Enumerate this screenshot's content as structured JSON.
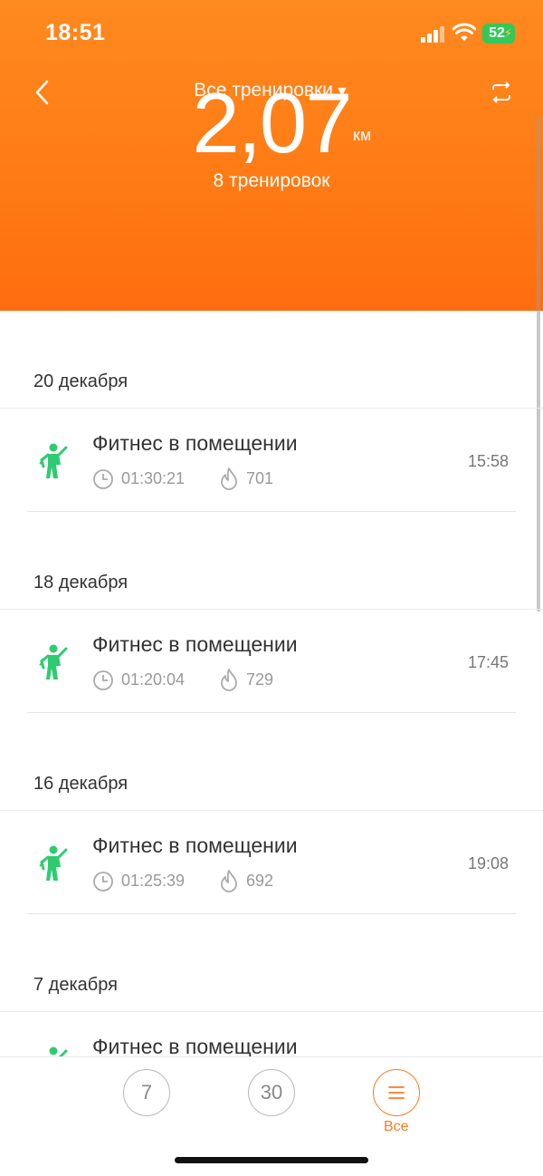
{
  "status_bar": {
    "time": "18:51",
    "battery": "52"
  },
  "header": {
    "title": "Все тренировки",
    "total_distance": "2,07",
    "unit": "км",
    "workouts_count": "8 тренировок"
  },
  "sections": [
    {
      "date": "20 декабря",
      "items": [
        {
          "name": "Фитнес в помещении",
          "duration": "01:30:21",
          "calories": "701",
          "time": "15:58"
        }
      ]
    },
    {
      "date": "18 декабря",
      "items": [
        {
          "name": "Фитнес в помещении",
          "duration": "01:20:04",
          "calories": "729",
          "time": "17:45"
        }
      ]
    },
    {
      "date": "16 декабря",
      "items": [
        {
          "name": "Фитнес в помещении",
          "duration": "01:25:39",
          "calories": "692",
          "time": "19:08"
        }
      ]
    },
    {
      "date": "7 декабря",
      "items": [
        {
          "name": "Фитнес в помещении"
        }
      ]
    }
  ],
  "tabs": [
    {
      "label": "7"
    },
    {
      "label": "30"
    },
    {
      "label": "Все",
      "icon": "list-icon",
      "active": true
    }
  ],
  "colors": {
    "accent": "#ff7a1e",
    "fitness_icon": "#2ecc71"
  }
}
